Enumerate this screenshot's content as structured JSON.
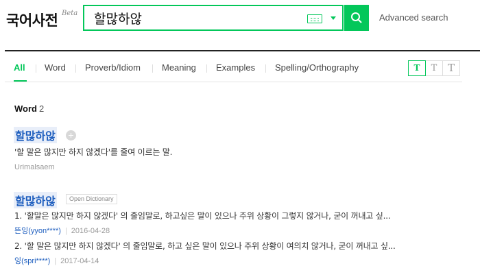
{
  "header": {
    "logo": "국어사전",
    "beta": "Beta",
    "search_value": "할많하않",
    "advanced_search": "Advanced search"
  },
  "tabs": {
    "all": "All",
    "word": "Word",
    "proverb": "Proverb/Idiom",
    "meaning": "Meaning",
    "examples": "Examples",
    "spelling": "Spelling/Orthography",
    "active": "All"
  },
  "font_size": [
    "T",
    "T",
    "T"
  ],
  "section": {
    "title": "Word",
    "count": "2"
  },
  "entries": [
    {
      "title": "할많하않",
      "definition": "'할 말은 많지만 하지 않겠다'를 줄여 이르는 말.",
      "source": "Urimalsaem"
    },
    {
      "title": "할많하않",
      "badge": "Open Dictionary",
      "definitions": [
        {
          "text": "1. '할말은 많지만 하지 않겠다' 의 줄임말로, 하고싶은 말이 있으나 주위 상황이 그렇지 않거나, 굳이 꺼내고 싶...",
          "author": "뜬잉(yyon****)",
          "date": "2016-04-28"
        },
        {
          "text": "2. '할 말은 많지만 하지 않겠다' 의 줄임말로, 하고 싶은 말이 있으나 주위 상황이 여의치 않거나, 굳이 꺼내고 싶...",
          "author": "잉(spri****)",
          "date": "2017-04-14"
        }
      ]
    }
  ],
  "colors": {
    "accent": "#03c75a",
    "link": "#1f5fbf"
  },
  "icons": [
    "search-icon",
    "keyboard-icon",
    "chevron-down-icon",
    "plus-icon"
  ]
}
